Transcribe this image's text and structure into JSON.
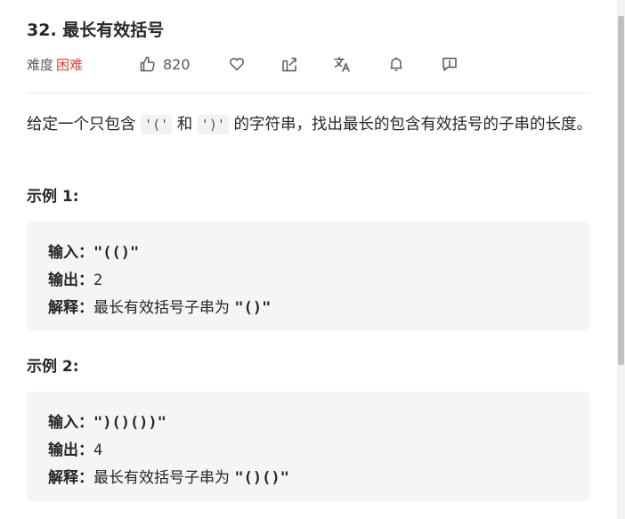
{
  "problem": {
    "title": "32. 最长有效括号",
    "difficulty_label": "难度",
    "difficulty_value": "困难",
    "likes": "820",
    "colors": {
      "hard": "#d5473d",
      "text": "#262626",
      "muted": "#595959"
    }
  },
  "toolbar": {
    "icons": [
      "thumbs-up-icon",
      "heart-icon",
      "share-icon",
      "translate-icon",
      "bell-icon",
      "feedback-icon"
    ]
  },
  "description": {
    "part1": "给定一个只包含 ",
    "code1": "'('",
    "part2": " 和 ",
    "code2": "')'",
    "part3": " 的字符串，找出最长的包含有效括号的子串的长度。"
  },
  "examples": [
    {
      "heading": "示例 1:",
      "input_label": "输入：",
      "input_value": "\"(()\"",
      "output_label": "输出：",
      "output_value": "2",
      "explain_label": "解释：",
      "explain_text": "最长有效括号子串为 ",
      "explain_value": "\"()\""
    },
    {
      "heading": "示例 2:",
      "input_label": "输入：",
      "input_value": "\")()())\"",
      "output_label": "输出：",
      "output_value": "4",
      "explain_label": "解释：",
      "explain_text": "最长有效括号子串为 ",
      "explain_value": "\"()()\""
    }
  ]
}
